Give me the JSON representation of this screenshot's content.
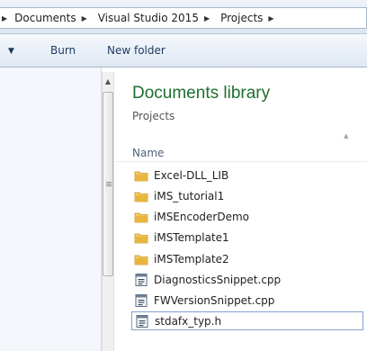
{
  "breadcrumb": {
    "items": [
      "Documents",
      "Visual Studio 2015",
      "Projects"
    ]
  },
  "toolbar": {
    "burn_label": "Burn",
    "new_folder_label": "New folder"
  },
  "library": {
    "title": "Documents library",
    "subtitle": "Projects",
    "column_name": "Name"
  },
  "files": [
    {
      "name": "Excel-DLL_LIB",
      "icon": "folder-icon"
    },
    {
      "name": "iMS_tutorial1",
      "icon": "folder-icon"
    },
    {
      "name": "iMSEncoderDemo",
      "icon": "folder-icon"
    },
    {
      "name": "iMSTemplate1",
      "icon": "folder-icon"
    },
    {
      "name": "iMSTemplate2",
      "icon": "folder-icon"
    },
    {
      "name": "DiagnosticsSnippet.cpp",
      "icon": "cpp-file-icon"
    },
    {
      "name": "FWVersionSnippet.cpp",
      "icon": "cpp-file-icon"
    },
    {
      "name": "stdafx_typ.h",
      "icon": "header-file-icon",
      "selected": true
    }
  ],
  "colors": {
    "library_title": "#1e6e2f",
    "selection_border": "#7da2ce",
    "folder": "#e8b53e"
  }
}
